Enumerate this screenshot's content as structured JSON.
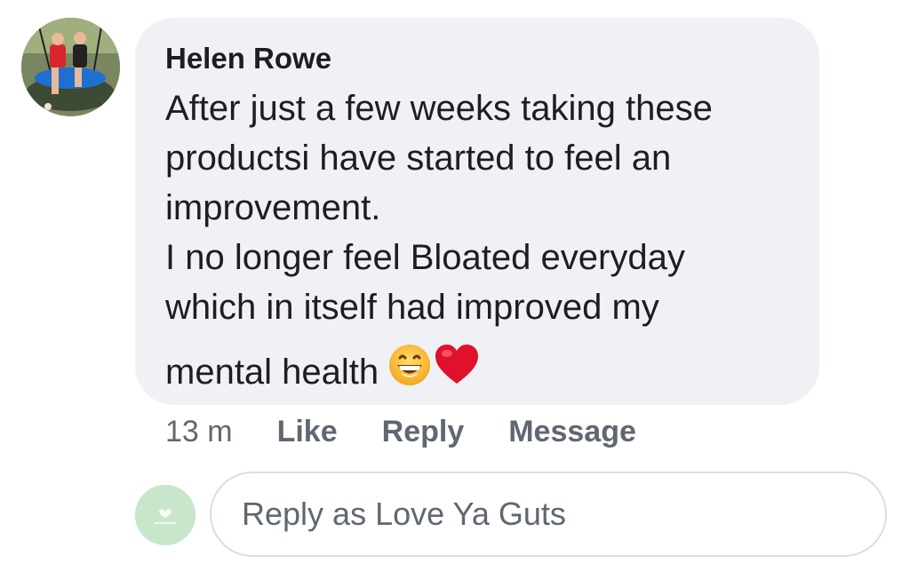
{
  "comment": {
    "author": "Helen Rowe",
    "lines": [
      "After just a few weeks taking these",
      "productsi have started to feel an",
      "improvement.",
      "I no longer feel Bloated everyday",
      "which in itself had improved my",
      "mental health"
    ],
    "emojis": [
      "grinning-face-icon",
      "red-heart-icon"
    ]
  },
  "actions": {
    "time": "13 m",
    "like": "Like",
    "reply": "Reply",
    "message": "Message"
  },
  "reply_box": {
    "placeholder": "Reply as Love Ya Guts",
    "value": ""
  },
  "colors": {
    "bubble": "#eff1f5",
    "text": "#1c1e21",
    "muted": "#606770",
    "page_avatar": "#c8e6c9",
    "heart": "#e0112b"
  }
}
